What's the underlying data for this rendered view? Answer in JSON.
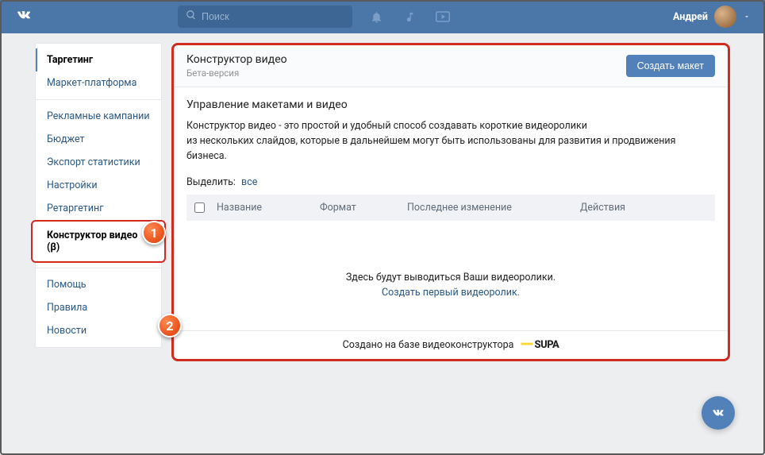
{
  "header": {
    "search_placeholder": "Поиск",
    "user_name": "Андрей"
  },
  "sidebar": {
    "group1": [
      {
        "label": "Таргетинг",
        "active": true
      },
      {
        "label": "Маркет-платформа"
      }
    ],
    "group2": [
      {
        "label": "Рекламные кампании"
      },
      {
        "label": "Бюджет"
      },
      {
        "label": "Экспорт статистики"
      },
      {
        "label": "Настройки"
      },
      {
        "label": "Ретаргетинг"
      },
      {
        "label": "Конструктор видео (β)",
        "boxed": true
      }
    ],
    "group3": [
      {
        "label": "Помощь"
      },
      {
        "label": "Правила"
      },
      {
        "label": "Новости"
      }
    ]
  },
  "main": {
    "title": "Конструктор видео",
    "beta": "Бета-версия",
    "create_button": "Создать макет",
    "subhead": "Управление макетами и видео",
    "desc_line1": "Конструктор видео - это простой и удобный способ создавать короткие видеоролики",
    "desc_line2": "из нескольких слайдов, которые в дальнейшем могут быть использованы для развития и продвижения бизнеса.",
    "select_label": "Выделить:",
    "select_all": "все",
    "columns": {
      "name": "Название",
      "format": "Формат",
      "last": "Последнее изменение",
      "actions": "Действия"
    },
    "empty_text": "Здесь будут выводиться Ваши видеоролики.",
    "empty_link": "Создать первый видеоролик.",
    "footer_text": "Создано на базе видеоконструктора",
    "footer_brand": "SUPA"
  },
  "annotations": {
    "badge1": "1",
    "badge2": "2"
  }
}
